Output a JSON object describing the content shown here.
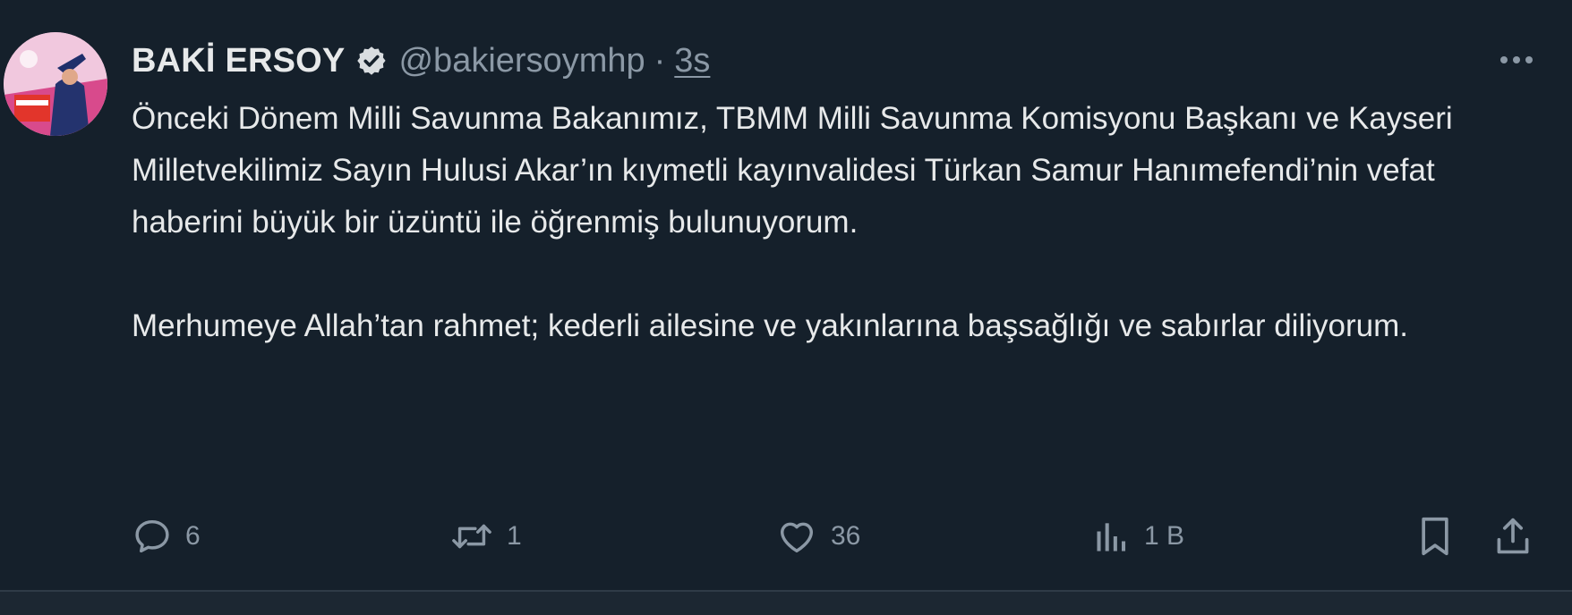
{
  "tweet": {
    "author_name": "BAKİ ERSOY",
    "handle": "@bakiersoymhp",
    "separator": "·",
    "time": "3s",
    "paragraphs": [
      "Önceki Dönem Milli Savunma Bakanımız, TBMM Milli Savunma Komisyonu Başkanı ve Kayseri Milletvekilimiz Sayın Hulusi Akar’ın kıymetli kayınvalidesi Türkan Samur Hanımefendi’nin vefat haberini büyük bir üzüntü ile öğrenmiş bulunuyorum.",
      "Merhumeye Allah’tan rahmet; kederli ailesine ve yakınlarına başsağlığı ve sabırlar diliyorum."
    ],
    "actions": {
      "reply_count": "6",
      "retweet_count": "1",
      "like_count": "36",
      "views_count": "1 B"
    }
  },
  "colors": {
    "background": "#15202b",
    "text": "#e7e9ea",
    "secondary_text": "#8b98a5",
    "verified_badge": "#e7e9ea"
  },
  "icons": {
    "verified": "verified-badge-icon",
    "more": "more-options-icon",
    "reply": "reply-icon",
    "retweet": "retweet-icon",
    "like": "heart-icon",
    "views": "analytics-icon",
    "bookmark": "bookmark-icon",
    "share": "share-icon"
  }
}
